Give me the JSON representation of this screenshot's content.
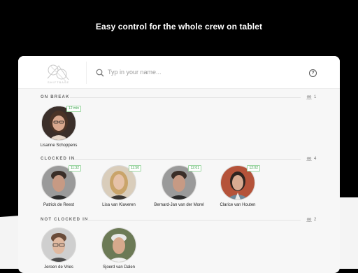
{
  "headline": "Easy control for the whole crew on tablet",
  "search": {
    "placeholder": "Typ in your name..."
  },
  "logo_text": "SHIFTBASE",
  "sections": [
    {
      "title": "ON BREAK",
      "count": "1",
      "people": [
        {
          "name": "Lisanne Schoppens",
          "badge": "12 min"
        }
      ]
    },
    {
      "title": "CLOCKED IN",
      "count": "4",
      "people": [
        {
          "name": "Patrick de Reest",
          "badge": "11:32"
        },
        {
          "name": "Lisa van Klaveren",
          "badge": "11:50"
        },
        {
          "name": "Bernard-Jan van der Morel",
          "badge": "12:01"
        },
        {
          "name": "Clarice van Houten",
          "badge": "12:02"
        }
      ]
    },
    {
      "title": "NOT CLOCKED IN",
      "count": "2",
      "people": [
        {
          "name": "Jeroen de Vries",
          "badge": ""
        },
        {
          "name": "Sjoerd van Dalen",
          "badge": ""
        }
      ]
    }
  ],
  "colors": {
    "badge_green": "#3aa14b",
    "background": "#000000",
    "panel": "#f7f7f7"
  }
}
